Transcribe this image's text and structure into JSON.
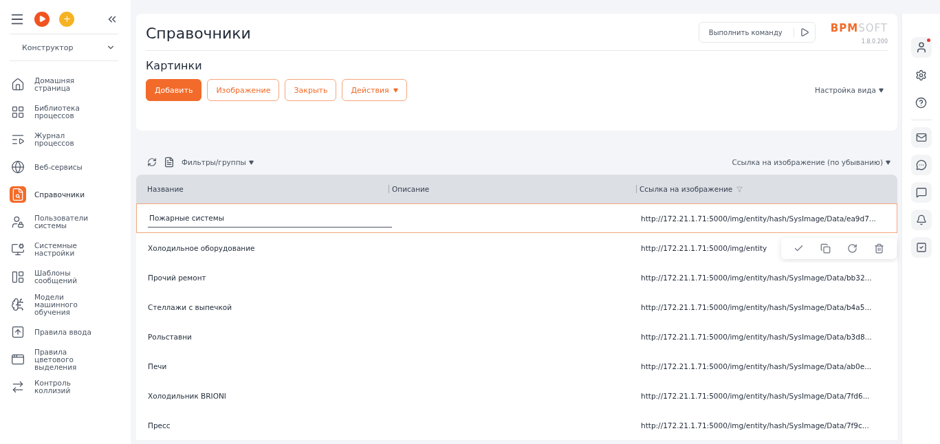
{
  "sidebar": {
    "section": "Конструктор",
    "items": [
      {
        "label": "Домашняя страница",
        "selected": false
      },
      {
        "label": "Библиотека процессов",
        "selected": false
      },
      {
        "label": "Журнал процессов",
        "selected": false
      },
      {
        "label": "Веб-сервисы",
        "selected": false
      },
      {
        "label": "Справочники",
        "selected": true
      },
      {
        "label": "Пользователи системы",
        "selected": false
      },
      {
        "label": "Системные настройки",
        "selected": false
      },
      {
        "label": "Шаблоны сообщений",
        "selected": false
      },
      {
        "label": "Модели машинного обучения",
        "selected": false
      },
      {
        "label": "Правила ввода",
        "selected": false
      },
      {
        "label": "Правила цветового выделения",
        "selected": false
      },
      {
        "label": "Контроль коллизий",
        "selected": false
      }
    ]
  },
  "header": {
    "title": "Справочники",
    "command": {
      "placeholder": "Выполнить команду"
    },
    "logo": {
      "accent": "BPM",
      "rest": "SOFT"
    },
    "version": "1.8.0.200"
  },
  "section": {
    "title": "Картинки",
    "buttons": [
      {
        "label": "Добавить",
        "kind": "primary"
      },
      {
        "label": "Изображение",
        "kind": "outline"
      },
      {
        "label": "Закрыть",
        "kind": "outline"
      },
      {
        "label": "Действия",
        "kind": "menu"
      }
    ],
    "view_settings": "Настройка вида"
  },
  "toolbar": {
    "filters": "Фильтры/группы",
    "sort": "Ссылка на изображение (по убыванию)"
  },
  "table": {
    "columns": [
      "Название",
      "Описание",
      "Ссылка на изображение"
    ],
    "rows": [
      {
        "name": "Пожарные системы",
        "link": "http://172.21.1.71:5000/img/entity/hash/SysImage/Data/ea9d7...",
        "selected": true
      },
      {
        "name": "Холодильное оборудование",
        "link": "http://172.21.1.71:5000/img/entity",
        "selected": false
      },
      {
        "name": "Прочий ремонт",
        "link": "http://172.21.1.71:5000/img/entity/hash/SysImage/Data/bb32...",
        "selected": false
      },
      {
        "name": "Стеллажи с выпечкой",
        "link": "http://172.21.1.71:5000/img/entity/hash/SysImage/Data/b4a5...",
        "selected": false
      },
      {
        "name": "Рольставни",
        "link": "http://172.21.1.71:5000/img/entity/hash/SysImage/Data/b3d8...",
        "selected": false
      },
      {
        "name": "Печи",
        "link": "http://172.21.1.71:5000/img/entity/hash/SysImage/Data/ab0e...",
        "selected": false
      },
      {
        "name": "Холодильник BRIONI",
        "link": "http://172.21.1.71:5000/img/entity/hash/SysImage/Data/7fd6...",
        "selected": false
      },
      {
        "name": "Пресс",
        "link": "http://172.21.1.71:5000/img/entity/hash/SysImage/Data/7f9c...",
        "selected": false
      }
    ]
  },
  "profile": {
    "notification": true
  }
}
